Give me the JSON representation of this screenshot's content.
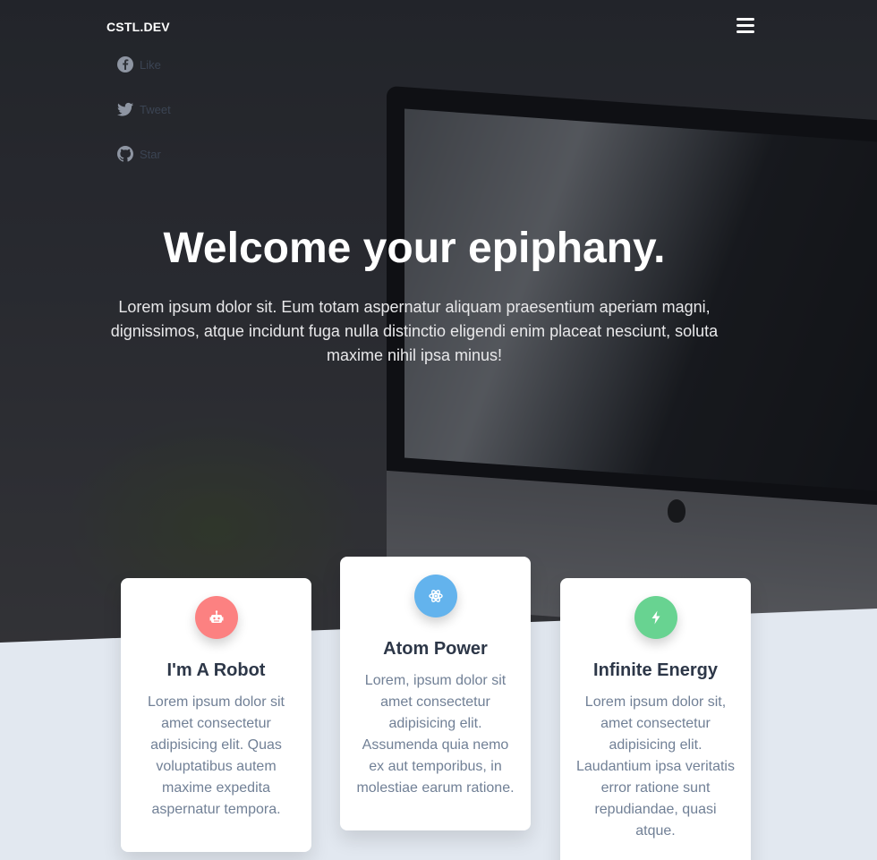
{
  "navbar": {
    "brand": "CSTL.DEV",
    "menu_icon": "bars-icon"
  },
  "social": [
    {
      "icon": "facebook-icon",
      "label": "Like"
    },
    {
      "icon": "twitter-icon",
      "label": "Tweet"
    },
    {
      "icon": "github-icon",
      "label": "Star"
    }
  ],
  "hero": {
    "title": "Welcome your epiphany.",
    "subtitle": "Lorem ipsum dolor sit. Eum totam aspernatur aliquam praesentium aperiam magni, dignissimos, atque incidunt fuga nulla distinctio eligendi enim placeat nesciunt, soluta maxime nihil ipsa minus!"
  },
  "features": [
    {
      "icon": "robot-icon",
      "color": "#fc8181",
      "title": "I'm A Robot",
      "body": "Lorem ipsum dolor sit amet consectetur adipisicing elit. Quas voluptatibus autem maxime expedita aspernatur tempora."
    },
    {
      "icon": "atom-icon",
      "color": "#63b3ed",
      "title": "Atom Power",
      "body": "Lorem, ipsum dolor sit amet consectetur adipisicing elit. Assumenda quia nemo ex aut temporibus, in molestiae earum ratione."
    },
    {
      "icon": "bolt-icon",
      "color": "#68d391",
      "title": "Infinite Energy",
      "body": "Lorem ipsum dolor sit, amet consectetur adipisicing elit. Laudantium ipsa veritatis error ratione sunt repudiandae, quasi atque."
    }
  ],
  "colors": {
    "hero_overlay": "#2a2c33",
    "section_background": "#e2e8f0",
    "card_text": "#718096",
    "card_title": "#2d3748"
  }
}
